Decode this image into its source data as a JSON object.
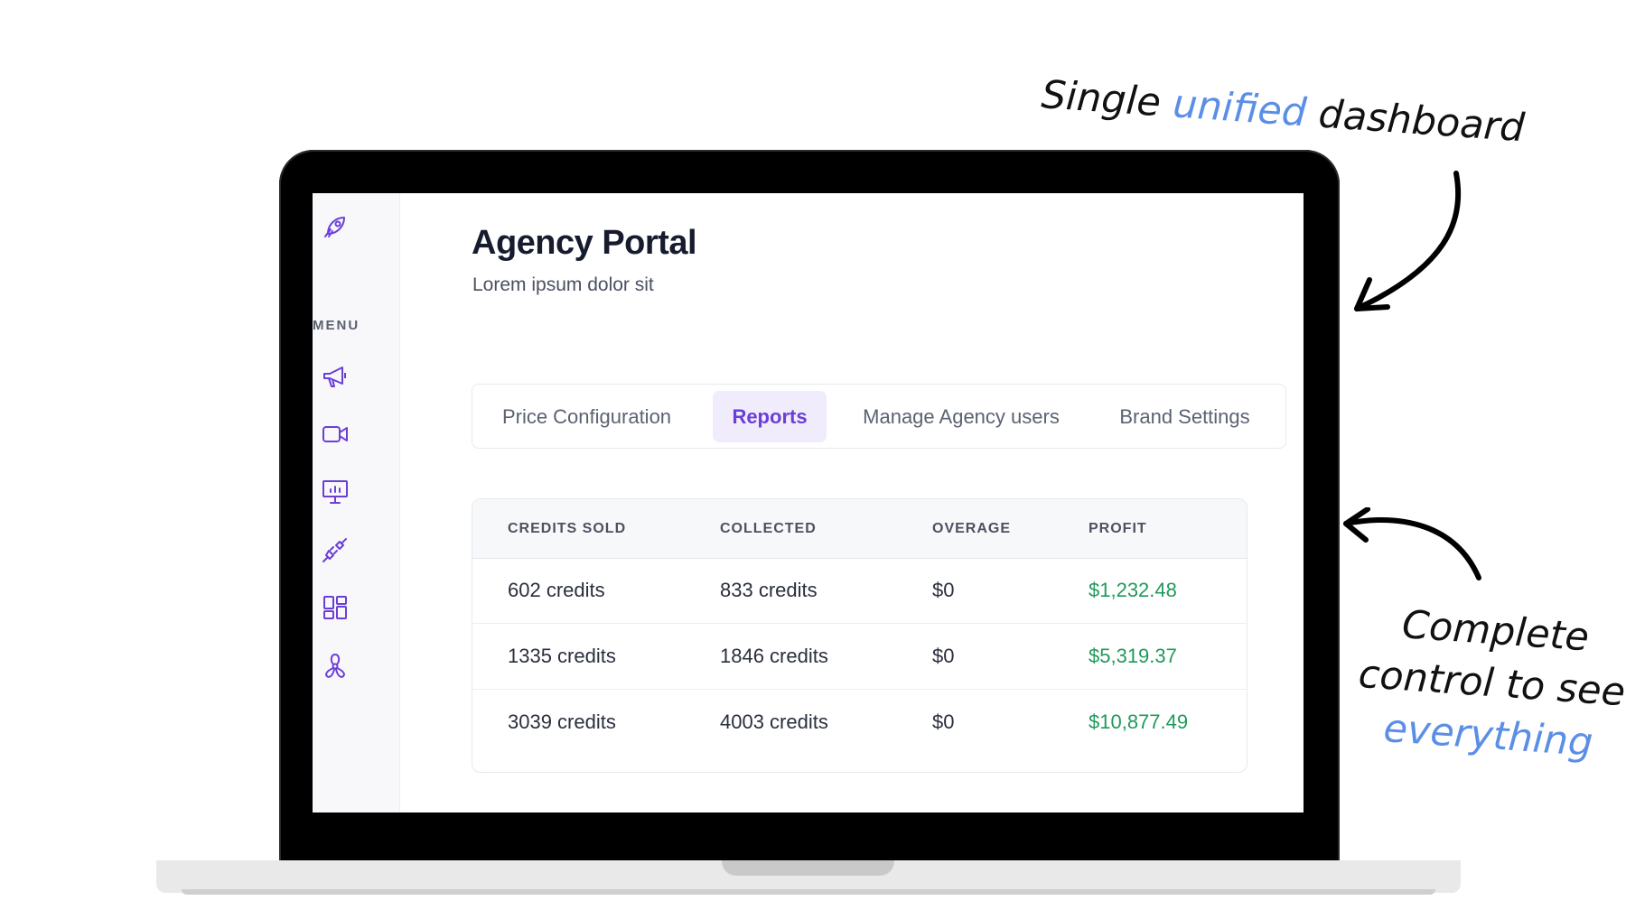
{
  "annotations": {
    "top": {
      "before": "Single ",
      "highlight": "unified",
      "after": " dashboard"
    },
    "right": {
      "line1": "Complete",
      "line2": "control to see",
      "highlight": "everything"
    }
  },
  "sidebar": {
    "menu_label": "MENU",
    "icons": [
      "rocket-icon",
      "megaphone-icon",
      "video-icon",
      "presentation-icon",
      "plug-icon",
      "dashboard-icon",
      "fan-icon"
    ]
  },
  "header": {
    "title": "Agency Portal",
    "subtitle": "Lorem ipsum dolor sit"
  },
  "tabs": [
    {
      "label": "Price Configuration",
      "active": false
    },
    {
      "label": "Reports",
      "active": true
    },
    {
      "label": "Manage Agency users",
      "active": false
    },
    {
      "label": "Brand Settings",
      "active": false
    }
  ],
  "table": {
    "columns": [
      "CREDITS SOLD",
      "COLLECTED",
      "OVERAGE",
      "PROFIT"
    ],
    "rows": [
      [
        "602 credits",
        "833 credits",
        "$0",
        "$1,232.48"
      ],
      [
        "1335 credits",
        "1846 credits",
        "$0",
        "$5,319.37"
      ],
      [
        "3039 credits",
        "4003 credits",
        "$0",
        "$10,877.49"
      ]
    ]
  },
  "colors": {
    "accent": "#6b3fd6",
    "profit": "#1f9a5a",
    "highlight": "#5b8fe6"
  }
}
